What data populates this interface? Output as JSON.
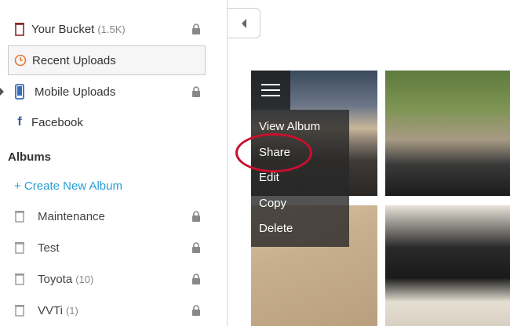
{
  "sidebar": {
    "items": [
      {
        "label": "Your Bucket",
        "count": "(1.5K)",
        "icon": "bucket-icon",
        "locked": true
      },
      {
        "label": "Recent Uploads",
        "icon": "clock-icon",
        "locked": false
      },
      {
        "label": "Mobile Uploads",
        "icon": "phone-icon",
        "locked": true
      },
      {
        "label": "Facebook",
        "icon": "facebook-icon",
        "locked": false
      }
    ],
    "albums_title": "Albums",
    "create_album": "+ Create New Album",
    "albums": [
      {
        "label": "Maintenance",
        "count": "",
        "locked": true
      },
      {
        "label": "Test",
        "count": "",
        "locked": true
      },
      {
        "label": "Toyota",
        "count": "(10)",
        "locked": true
      },
      {
        "label": "VVTi",
        "count": "(1)",
        "locked": true
      }
    ]
  },
  "context_menu": {
    "items": [
      "View Album",
      "Share",
      "Edit",
      "Copy",
      "Delete"
    ]
  },
  "colors": {
    "link": "#2a9fd6",
    "annotation": "#c8102e",
    "clock": "#e07a3a",
    "phone": "#3a6fb5",
    "bucket": "#8a2a2a"
  }
}
